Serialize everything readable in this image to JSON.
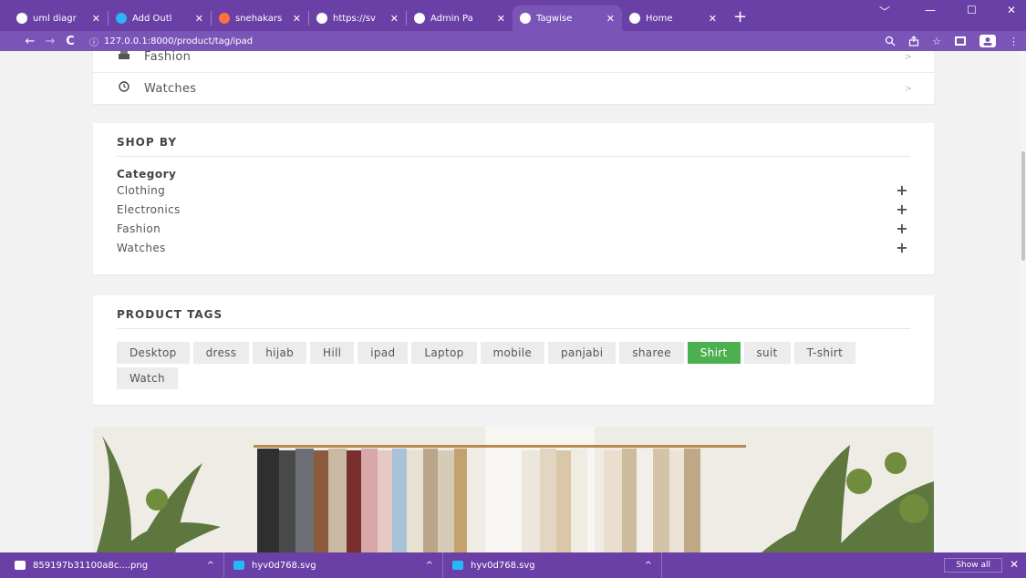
{
  "browser": {
    "tabs": [
      {
        "title": "uml diagr",
        "icon": "google-icon",
        "active": false
      },
      {
        "title": "Add Outl",
        "icon": "outline-icon",
        "active": false
      },
      {
        "title": "snehakars",
        "icon": "cloud-icon",
        "active": false
      },
      {
        "title": "https://sv",
        "icon": "globe-icon",
        "active": false
      },
      {
        "title": "Admin Pa",
        "icon": "globe-icon",
        "active": false
      },
      {
        "title": "Tagwise",
        "icon": "globe-icon",
        "active": true
      },
      {
        "title": "Home",
        "icon": "globe-icon",
        "active": false
      }
    ],
    "close_glyph": "✕",
    "new_tab": "+",
    "window_controls": [
      "﹀",
      "—",
      "☐",
      "✕"
    ],
    "url": "127.0.0.1:8000/product/tag/ipad",
    "colors": {
      "chrome": "#6a3fa6",
      "active_tab": "#7b54b8"
    }
  },
  "categories_card": {
    "items": [
      {
        "label": "Fashion",
        "icon": "fashion-icon"
      },
      {
        "label": "Watches",
        "icon": "clock-icon"
      }
    ]
  },
  "shop_by": {
    "title": "SHOP BY",
    "filter_heading": "Category",
    "items": [
      "Clothing",
      "Electronics",
      "Fashion",
      "Watches"
    ],
    "expand_glyph": "+"
  },
  "product_tags": {
    "title": "PRODUCT TAGS",
    "tags": [
      "Desktop",
      "dress",
      "hijab",
      "Hill",
      "ipad",
      "Laptop",
      "mobile",
      "panjabi",
      "sharee",
      "Shirt",
      "suit",
      "T-shirt",
      "Watch"
    ],
    "active_tag": "Shirt",
    "active_color": "#4caf50"
  },
  "downloads": {
    "items": [
      {
        "name": "859197b31100a8c....png",
        "icon": "image-file-icon"
      },
      {
        "name": "hyv0d768.svg",
        "icon": "edge-icon"
      },
      {
        "name": "hyv0d768.svg",
        "icon": "edge-icon"
      }
    ],
    "show_all": "Show all",
    "close_glyph": "✕"
  }
}
